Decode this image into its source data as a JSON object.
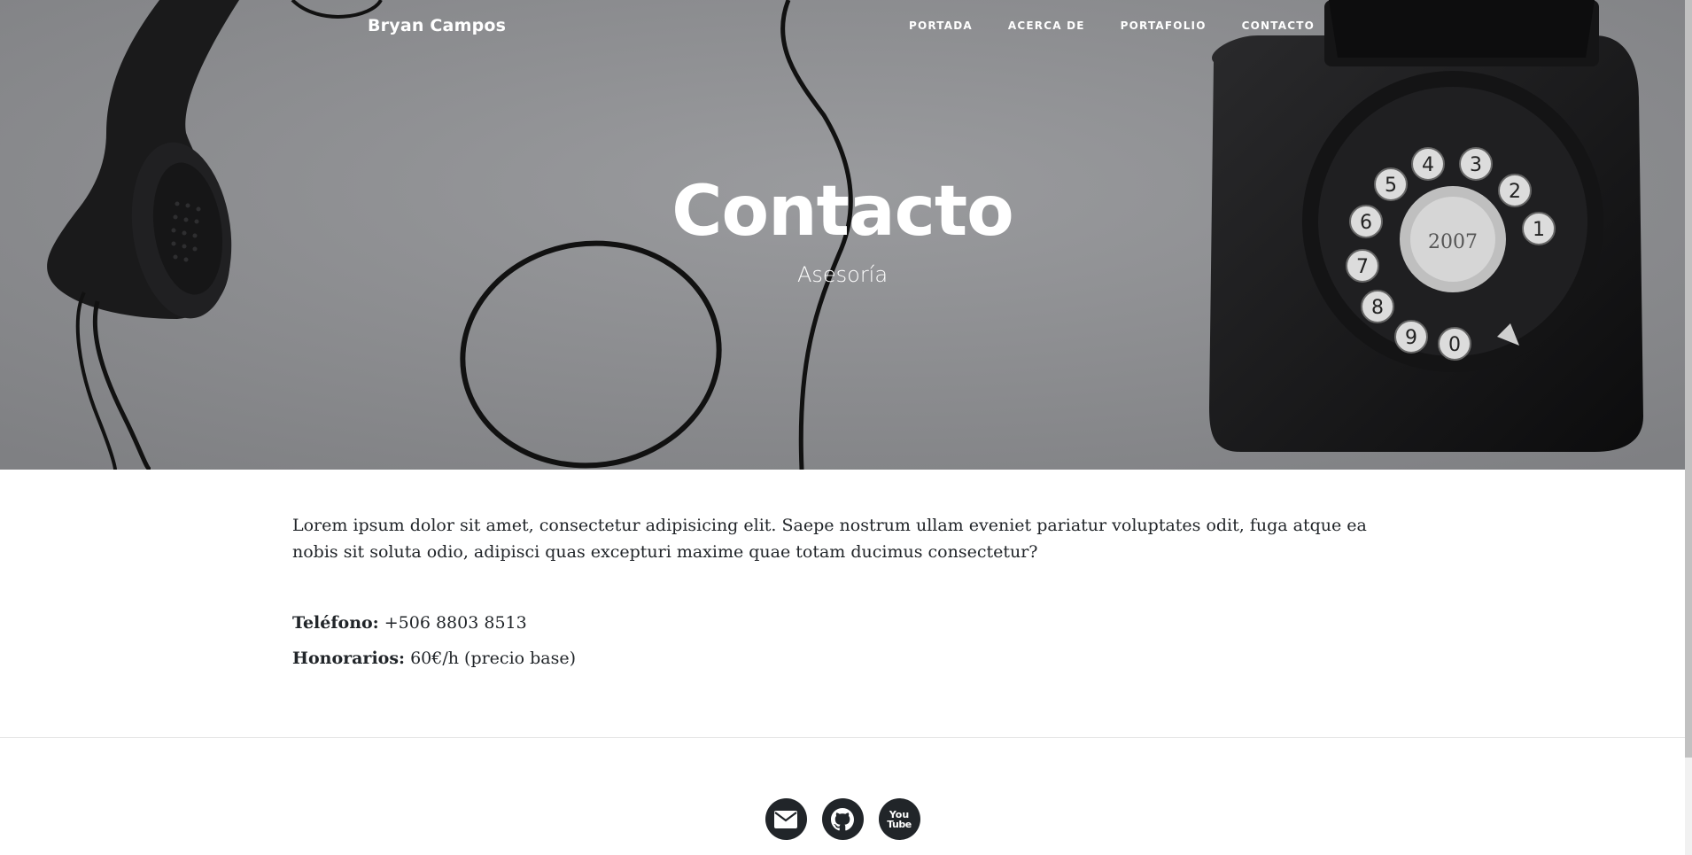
{
  "navbar": {
    "brand": "Bryan Campos",
    "links": [
      "PORTADA",
      "ACERCA DE",
      "PORTAFOLIO",
      "CONTACTO"
    ]
  },
  "hero": {
    "title": "Contacto",
    "subtitle": "Asesoría"
  },
  "content": {
    "intro": "Lorem ipsum dolor sit amet, consectetur adipisicing elit. Saepe nostrum ullam eveniet pariatur voluptates odit, fuga atque ea nobis sit soluta odio, adipisci quas excepturi maxime quae totam ducimus consectetur?",
    "phone_label": "Teléfono:",
    "phone_value": " +506 8803 8513",
    "fees_label": "Honorarios:",
    "fees_value": " 60€/h (precio base)"
  },
  "footer": {
    "social": [
      "envelope-icon",
      "github-icon",
      "youtube-icon"
    ],
    "youtube_top": "You",
    "youtube_bottom": "Tube"
  },
  "colors": {
    "hero_bg": "#8e8f92",
    "text": "#212529",
    "social_bg": "#212529"
  }
}
